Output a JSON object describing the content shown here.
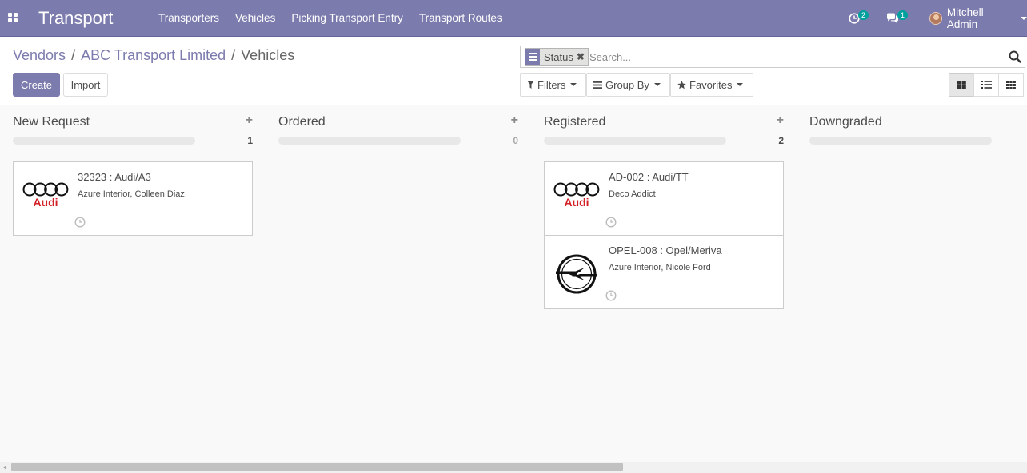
{
  "app": {
    "title": "Transport",
    "menu": [
      "Transporters",
      "Vehicles",
      "Picking Transport Entry",
      "Transport Routes"
    ],
    "activity_count": "2",
    "message_count": "1",
    "user_name": "Mitchell Admin"
  },
  "breadcrumb": {
    "items": [
      "Vendors",
      "ABC Transport Limited"
    ],
    "separator": "/",
    "current": "Vehicles"
  },
  "buttons": {
    "create": "Create",
    "import": "Import"
  },
  "search": {
    "facet": "Status",
    "facet_remove": "✖",
    "placeholder": "Search..."
  },
  "dropdowns": {
    "filters": "Filters",
    "group_by": "Group By",
    "favorites": "Favorites"
  },
  "views": [
    "kanban-view",
    "list-view",
    "grid-view"
  ],
  "active_view": "kanban-view",
  "columns": [
    {
      "title": "New Request",
      "count": "1",
      "cards": [
        {
          "title": "32323 : Audi/A3",
          "subtitle": "Azure Interior, Colleen Diaz",
          "logo": "audi",
          "logo_text": "Audi"
        }
      ]
    },
    {
      "title": "Ordered",
      "count": "0",
      "cards": []
    },
    {
      "title": "Registered",
      "count": "2",
      "cards": [
        {
          "title": "AD-002 : Audi/TT",
          "subtitle": "Deco Addict",
          "logo": "audi",
          "logo_text": "Audi"
        },
        {
          "title": "OPEL-008 : Opel/Meriva",
          "subtitle": "Azure Interior, Nicole Ford",
          "logo": "opel"
        }
      ]
    },
    {
      "title": "Downgraded",
      "count": "",
      "cards": []
    }
  ],
  "colors": {
    "primary": "#7c7bad",
    "badge": "#00a09d",
    "audi_red": "#d42027"
  }
}
